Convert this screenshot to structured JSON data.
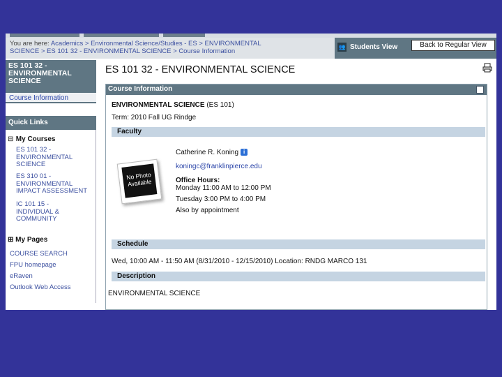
{
  "breadcrumb": {
    "prefix": "You are here:",
    "line1": "Academics > Environmental Science/Studies - ES > ENVIRONMENTAL",
    "line2": "SCIENCE > ES 101 32 - ENVIRONMENTAL SCIENCE > Course Information"
  },
  "viewbar": {
    "students_view": "Students View",
    "back_button": "Back to Regular View"
  },
  "sidebar": {
    "course_title": [
      "ES 101 32 -",
      "ENVIRONMENTAL",
      "SCIENCE"
    ],
    "course_info_link": "Course Information",
    "quick_links": "Quick Links",
    "my_courses": "My Courses",
    "my_courses_toggle": "⊟",
    "courses": [
      [
        "ES 101 32 -",
        "ENVIRONMENTAL",
        "SCIENCE"
      ],
      [
        "ES 310 01 -",
        "ENVIRONMENTAL",
        "IMPACT ASSESSMENT"
      ],
      [
        "IC 101 15 -",
        "INDIVIDUAL &",
        "COMMUNITY"
      ]
    ],
    "my_pages": "My Pages",
    "my_pages_toggle": "⊞",
    "pages": [
      "COURSE SEARCH",
      "FPU homepage",
      "eRaven",
      "Outlook Web Access"
    ]
  },
  "main": {
    "title": "ES 101 32 - ENVIRONMENTAL SCIENCE",
    "panel_title": "Course Information",
    "course_name": "ENVIRONMENTAL SCIENCE",
    "course_code": "(ES 101)",
    "term": "Term: 2010 Fall UG Rindge",
    "faculty_header": "Faculty",
    "photo_text": [
      "No Photo",
      "Available"
    ],
    "faculty_name": "Catherine R. Koning",
    "faculty_email": "koningc@franklinpierce.edu",
    "office_hours_label": "Office Hours:",
    "office_hours": [
      "Monday 11:00 AM to 12:00 PM",
      "Tuesday 3:00 PM to 4:00 PM",
      "Also by appointment"
    ],
    "schedule_header": "Schedule",
    "schedule_text": "Wed, 10:00 AM - 11:50 AM (8/31/2010 - 12/15/2010) Location: RNDG MARCO 131",
    "description_header": "Description",
    "description_text": "ENVIRONMENTAL SCIENCE"
  },
  "colors": {
    "background": "#333399",
    "header_bar": "#5f7683",
    "section_bar": "#c5d4e2",
    "link": "#3c50a0"
  }
}
